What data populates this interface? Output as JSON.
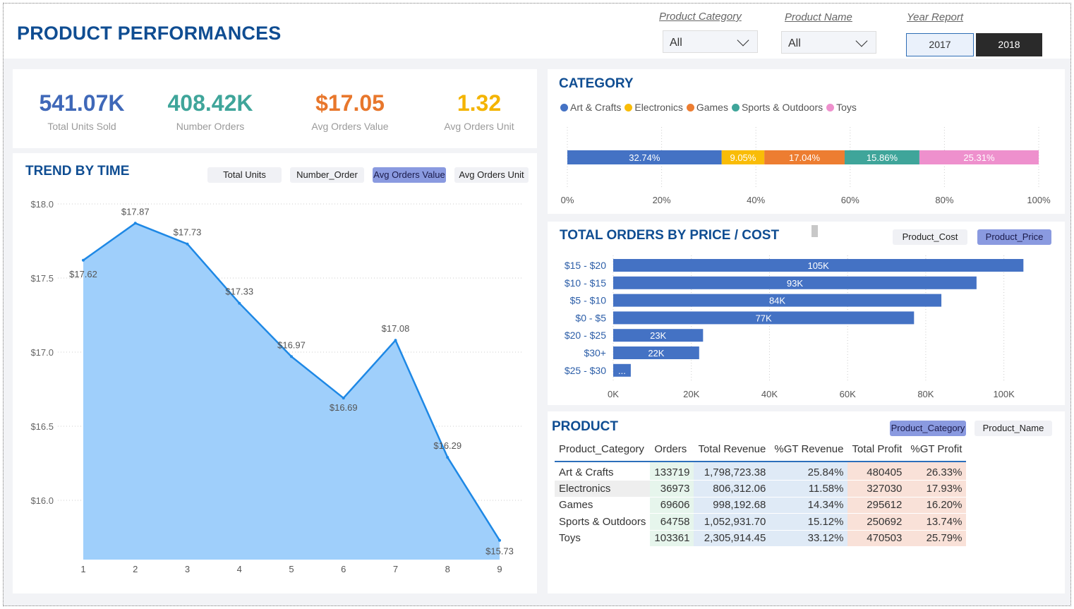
{
  "header": {
    "title": "PRODUCT PERFORMANCES",
    "filters": {
      "category_label": "Product Category",
      "category_value": "All",
      "name_label": "Product Name",
      "name_value": "All",
      "year_label": "Year Report",
      "years": [
        "2017",
        "2018"
      ],
      "selected_year": "2018"
    }
  },
  "kpis": [
    {
      "value": "541.07K",
      "label": "Total Units Sold",
      "color": "#3f68b8"
    },
    {
      "value": "408.42K",
      "label": "Number Orders",
      "color": "#3fa59a"
    },
    {
      "value": "$17.05",
      "label": "Avg Orders Value",
      "color": "#e8772c"
    },
    {
      "value": "1.32",
      "label": "Avg Orders Unit",
      "color": "#f4b400"
    }
  ],
  "trend": {
    "title": "TREND BY TIME",
    "buttons": [
      "Total Units",
      "Number_Order",
      "Avg Orders Value",
      "Avg Orders Unit"
    ],
    "active_button": "Avg Orders Value"
  },
  "category": {
    "title": "CATEGORY"
  },
  "orders_by_price": {
    "title": "TOTAL ORDERS BY PRICE / COST",
    "buttons": [
      "Product_Cost",
      "Product_Price"
    ],
    "active_button": "Product_Price"
  },
  "product": {
    "title": "PRODUCT",
    "buttons": [
      "Product_Category",
      "Product_Name"
    ],
    "active_button": "Product_Category",
    "headers": [
      "Product_Category",
      "Orders",
      "Total Revenue",
      "%GT Revenue",
      "Total Profit",
      "%GT Profit"
    ],
    "rows": [
      [
        "Art & Crafts",
        "133719",
        "1,798,723.38",
        "25.84%",
        "480405",
        "26.33%"
      ],
      [
        "Electronics",
        "36973",
        "806,312.06",
        "11.58%",
        "327030",
        "17.93%"
      ],
      [
        "Games",
        "69606",
        "998,192.68",
        "14.34%",
        "295612",
        "16.20%"
      ],
      [
        "Sports & Outdoors",
        "64758",
        "1,052,931.70",
        "15.12%",
        "250692",
        "13.74%"
      ],
      [
        "Toys",
        "103361",
        "2,305,914.45",
        "33.12%",
        "470503",
        "25.79%"
      ]
    ],
    "colors": {
      "orders": "#e6f5ec",
      "revenue": "#dfeaf6",
      "profit": "#f9e1d8"
    }
  },
  "chart_data": [
    {
      "type": "area",
      "title": "TREND BY TIME",
      "x": [
        1,
        2,
        3,
        4,
        5,
        6,
        7,
        8,
        9
      ],
      "series": [
        {
          "values": [
            17.62,
            17.87,
            17.73,
            17.33,
            16.97,
            16.69,
            17.08,
            16.29,
            15.73
          ]
        }
      ],
      "data_labels": [
        "$17.62",
        "$17.87",
        "$17.73",
        "$17.33",
        "$16.97",
        "$16.69",
        "$17.08",
        "$16.29",
        "$15.73"
      ],
      "ylim": [
        15.6,
        18.0
      ],
      "yticks": [
        16.0,
        16.5,
        17.0,
        17.5,
        18.0
      ],
      "ytick_labels": [
        "$16.0",
        "$16.5",
        "$17.0",
        "$17.5",
        "$18.0"
      ],
      "grid": true,
      "colors": {
        "fill": "#9fcffb",
        "line": "#1e88e5"
      }
    },
    {
      "type": "bar",
      "orientation": "horizontal-stacked-100",
      "title": "CATEGORY",
      "series": [
        {
          "name": "Art & Crafts",
          "value": 32.74,
          "label": "32.74%",
          "color": "#4472c4"
        },
        {
          "name": "Electronics",
          "value": 9.05,
          "label": "9.05%",
          "color": "#f9bc07"
        },
        {
          "name": "Games",
          "value": 17.04,
          "label": "17.04%",
          "color": "#ed7d31"
        },
        {
          "name": "Sports & Outdoors",
          "value": 15.86,
          "label": "15.86%",
          "color": "#3fa59a"
        },
        {
          "name": "Toys",
          "value": 25.31,
          "label": "25.31%",
          "color": "#ee90cd"
        }
      ],
      "xlim": [
        0,
        100
      ],
      "xtick_labels": [
        "0%",
        "20%",
        "40%",
        "60%",
        "80%",
        "100%"
      ],
      "legend": "top-left",
      "grid": true
    },
    {
      "type": "bar",
      "orientation": "horizontal",
      "title": "TOTAL ORDERS BY PRICE / COST",
      "categories": [
        "$15 - $20",
        "$10 - $15",
        "$5 - $10",
        "$0 - $5",
        "$20 - $25",
        "$30+",
        "$25 - $30"
      ],
      "values": [
        105000,
        93000,
        84000,
        77000,
        23000,
        22000,
        4500
      ],
      "data_labels": [
        "105K",
        "93K",
        "84K",
        "77K",
        "23K",
        "22K",
        "..."
      ],
      "xlim": [
        0,
        110000
      ],
      "xtick_labels": [
        "0K",
        "20K",
        "40K",
        "60K",
        "80K",
        "100K"
      ],
      "color": "#4472c4",
      "grid": true
    }
  ]
}
